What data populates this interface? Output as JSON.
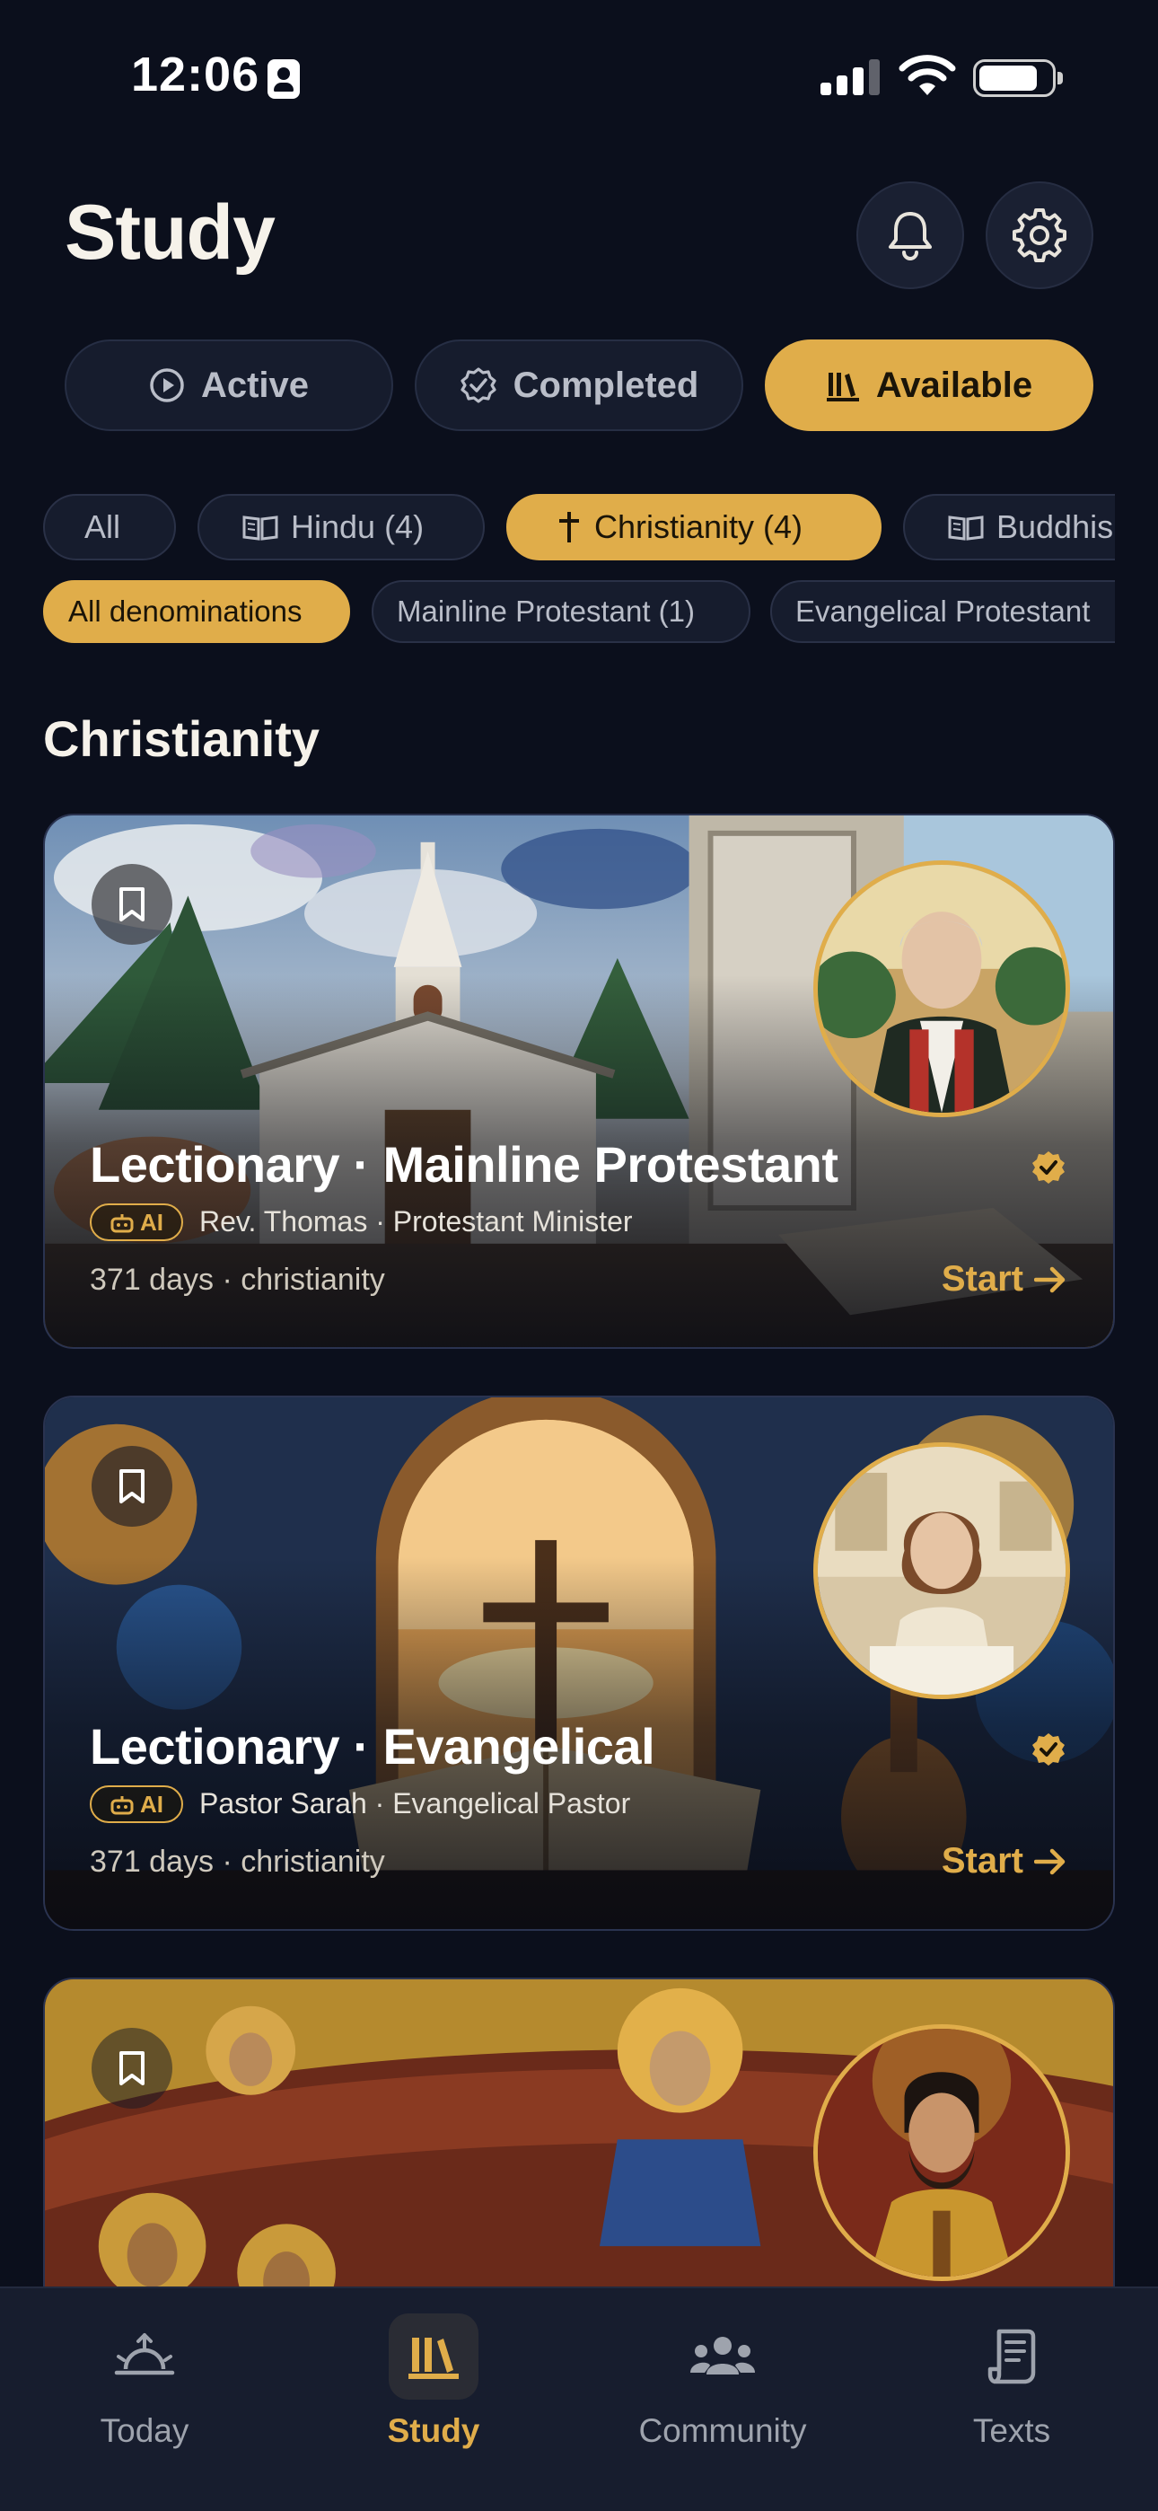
{
  "status_bar": {
    "time": "12:06"
  },
  "header": {
    "title": "Study"
  },
  "tabs": [
    {
      "label": "Active",
      "icon": "play-circle-icon"
    },
    {
      "label": "Completed",
      "icon": "check-badge-icon"
    },
    {
      "label": "Available",
      "icon": "library-icon",
      "selected": true
    }
  ],
  "traditions": [
    {
      "label": "All"
    },
    {
      "label": "Hindu (4)",
      "icon": "book-icon"
    },
    {
      "label": "Christianity (4)",
      "icon": "cross-icon",
      "selected": true
    },
    {
      "label": "Buddhis",
      "icon": "book-icon"
    }
  ],
  "denominations": [
    {
      "label": "All denominations",
      "selected": true
    },
    {
      "label": "Mainline Protestant (1)"
    },
    {
      "label": "Evangelical Protestant"
    }
  ],
  "section_title": "Christianity",
  "cards": [
    {
      "title": "Lectionary · Mainline Protestant",
      "badge": "AI",
      "guide": "Rev. Thomas · Protestant Minister",
      "meta": "371 days · christianity",
      "action": "Start",
      "verified": true
    },
    {
      "title": "Lectionary · Evangelical",
      "badge": "AI",
      "guide": "Pastor Sarah · Evangelical Pastor",
      "meta": "371 days · christianity",
      "action": "Start",
      "verified": true
    },
    {
      "title": "",
      "badge": "",
      "guide": "",
      "meta": "",
      "action": "",
      "verified": false
    }
  ],
  "bottom_nav": [
    {
      "label": "Today",
      "icon": "sunrise-icon"
    },
    {
      "label": "Study",
      "icon": "library-icon",
      "selected": true
    },
    {
      "label": "Community",
      "icon": "people-icon"
    },
    {
      "label": "Texts",
      "icon": "document-icon"
    }
  ],
  "colors": {
    "background": "#0b0f1c",
    "accent": "#e0ad4a",
    "surface": "#161c2d",
    "nav": "#171d2e"
  }
}
